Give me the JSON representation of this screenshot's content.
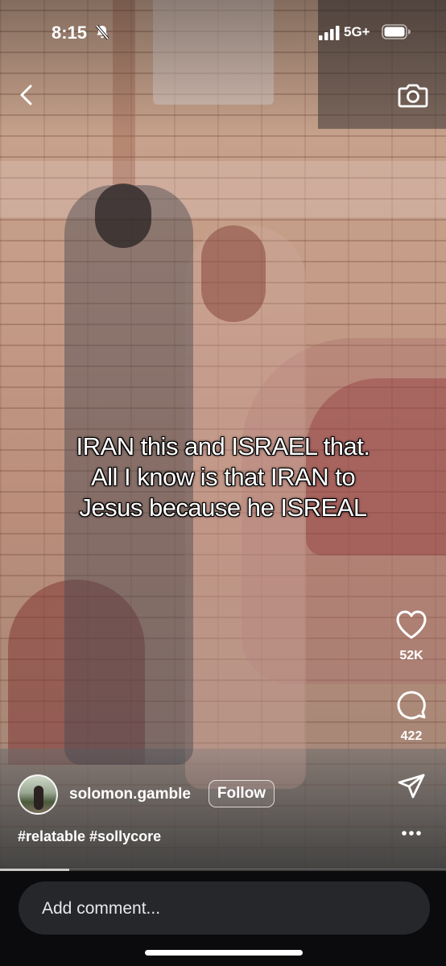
{
  "status_bar": {
    "time": "8:15",
    "network": "5G+",
    "icons": [
      "bell-muted-icon",
      "signal-icon",
      "battery-icon"
    ]
  },
  "header": {
    "icons": [
      "back-icon",
      "camera-icon"
    ]
  },
  "video": {
    "caption": "IRAN this and ISRAEL that.\nAll I know is that IRAN to\nJesus because he ISREAL",
    "progress": 0.155
  },
  "actions": {
    "likes": "52K",
    "comments": "422",
    "icons": [
      "heart-icon",
      "comment-icon",
      "share-icon",
      "more-icon"
    ]
  },
  "author": {
    "username": "solomon.gamble",
    "follow_label": "Follow"
  },
  "post": {
    "hashtags": "#relatable #sollycore"
  },
  "comment_bar": {
    "placeholder": "Add comment..."
  },
  "colors": {
    "bottom_bar": "#0b0b0d",
    "comment_box": "#25272b",
    "text": "#ffffff"
  }
}
